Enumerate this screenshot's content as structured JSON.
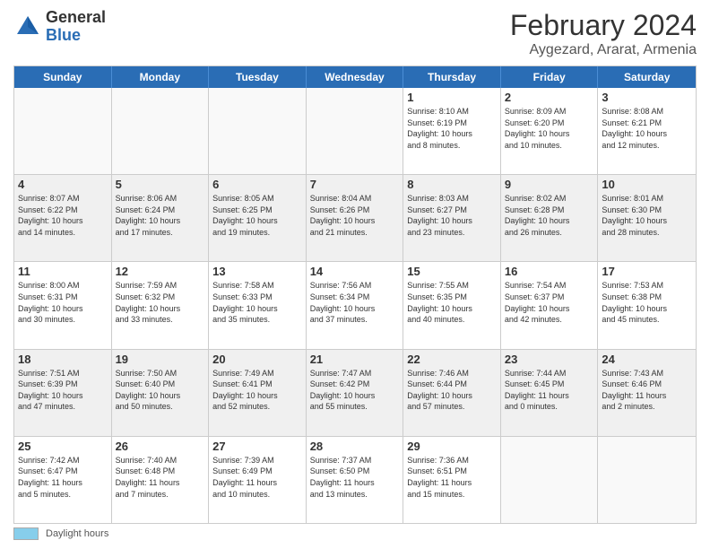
{
  "header": {
    "logo_general": "General",
    "logo_blue": "Blue",
    "main_title": "February 2024",
    "subtitle": "Aygezard, Ararat, Armenia"
  },
  "calendar": {
    "weekdays": [
      "Sunday",
      "Monday",
      "Tuesday",
      "Wednesday",
      "Thursday",
      "Friday",
      "Saturday"
    ],
    "weeks": [
      [
        {
          "day": "",
          "info": "",
          "empty": true
        },
        {
          "day": "",
          "info": "",
          "empty": true
        },
        {
          "day": "",
          "info": "",
          "empty": true
        },
        {
          "day": "",
          "info": "",
          "empty": true
        },
        {
          "day": "1",
          "info": "Sunrise: 8:10 AM\nSunset: 6:19 PM\nDaylight: 10 hours\nand 8 minutes."
        },
        {
          "day": "2",
          "info": "Sunrise: 8:09 AM\nSunset: 6:20 PM\nDaylight: 10 hours\nand 10 minutes."
        },
        {
          "day": "3",
          "info": "Sunrise: 8:08 AM\nSunset: 6:21 PM\nDaylight: 10 hours\nand 12 minutes."
        }
      ],
      [
        {
          "day": "4",
          "info": "Sunrise: 8:07 AM\nSunset: 6:22 PM\nDaylight: 10 hours\nand 14 minutes."
        },
        {
          "day": "5",
          "info": "Sunrise: 8:06 AM\nSunset: 6:24 PM\nDaylight: 10 hours\nand 17 minutes."
        },
        {
          "day": "6",
          "info": "Sunrise: 8:05 AM\nSunset: 6:25 PM\nDaylight: 10 hours\nand 19 minutes."
        },
        {
          "day": "7",
          "info": "Sunrise: 8:04 AM\nSunset: 6:26 PM\nDaylight: 10 hours\nand 21 minutes."
        },
        {
          "day": "8",
          "info": "Sunrise: 8:03 AM\nSunset: 6:27 PM\nDaylight: 10 hours\nand 23 minutes."
        },
        {
          "day": "9",
          "info": "Sunrise: 8:02 AM\nSunset: 6:28 PM\nDaylight: 10 hours\nand 26 minutes."
        },
        {
          "day": "10",
          "info": "Sunrise: 8:01 AM\nSunset: 6:30 PM\nDaylight: 10 hours\nand 28 minutes."
        }
      ],
      [
        {
          "day": "11",
          "info": "Sunrise: 8:00 AM\nSunset: 6:31 PM\nDaylight: 10 hours\nand 30 minutes."
        },
        {
          "day": "12",
          "info": "Sunrise: 7:59 AM\nSunset: 6:32 PM\nDaylight: 10 hours\nand 33 minutes."
        },
        {
          "day": "13",
          "info": "Sunrise: 7:58 AM\nSunset: 6:33 PM\nDaylight: 10 hours\nand 35 minutes."
        },
        {
          "day": "14",
          "info": "Sunrise: 7:56 AM\nSunset: 6:34 PM\nDaylight: 10 hours\nand 37 minutes."
        },
        {
          "day": "15",
          "info": "Sunrise: 7:55 AM\nSunset: 6:35 PM\nDaylight: 10 hours\nand 40 minutes."
        },
        {
          "day": "16",
          "info": "Sunrise: 7:54 AM\nSunset: 6:37 PM\nDaylight: 10 hours\nand 42 minutes."
        },
        {
          "day": "17",
          "info": "Sunrise: 7:53 AM\nSunset: 6:38 PM\nDaylight: 10 hours\nand 45 minutes."
        }
      ],
      [
        {
          "day": "18",
          "info": "Sunrise: 7:51 AM\nSunset: 6:39 PM\nDaylight: 10 hours\nand 47 minutes."
        },
        {
          "day": "19",
          "info": "Sunrise: 7:50 AM\nSunset: 6:40 PM\nDaylight: 10 hours\nand 50 minutes."
        },
        {
          "day": "20",
          "info": "Sunrise: 7:49 AM\nSunset: 6:41 PM\nDaylight: 10 hours\nand 52 minutes."
        },
        {
          "day": "21",
          "info": "Sunrise: 7:47 AM\nSunset: 6:42 PM\nDaylight: 10 hours\nand 55 minutes."
        },
        {
          "day": "22",
          "info": "Sunrise: 7:46 AM\nSunset: 6:44 PM\nDaylight: 10 hours\nand 57 minutes."
        },
        {
          "day": "23",
          "info": "Sunrise: 7:44 AM\nSunset: 6:45 PM\nDaylight: 11 hours\nand 0 minutes."
        },
        {
          "day": "24",
          "info": "Sunrise: 7:43 AM\nSunset: 6:46 PM\nDaylight: 11 hours\nand 2 minutes."
        }
      ],
      [
        {
          "day": "25",
          "info": "Sunrise: 7:42 AM\nSunset: 6:47 PM\nDaylight: 11 hours\nand 5 minutes."
        },
        {
          "day": "26",
          "info": "Sunrise: 7:40 AM\nSunset: 6:48 PM\nDaylight: 11 hours\nand 7 minutes."
        },
        {
          "day": "27",
          "info": "Sunrise: 7:39 AM\nSunset: 6:49 PM\nDaylight: 11 hours\nand 10 minutes."
        },
        {
          "day": "28",
          "info": "Sunrise: 7:37 AM\nSunset: 6:50 PM\nDaylight: 11 hours\nand 13 minutes."
        },
        {
          "day": "29",
          "info": "Sunrise: 7:36 AM\nSunset: 6:51 PM\nDaylight: 11 hours\nand 15 minutes."
        },
        {
          "day": "",
          "info": "",
          "empty": true
        },
        {
          "day": "",
          "info": "",
          "empty": true
        }
      ]
    ]
  },
  "footer": {
    "daylight_label": "Daylight hours"
  }
}
